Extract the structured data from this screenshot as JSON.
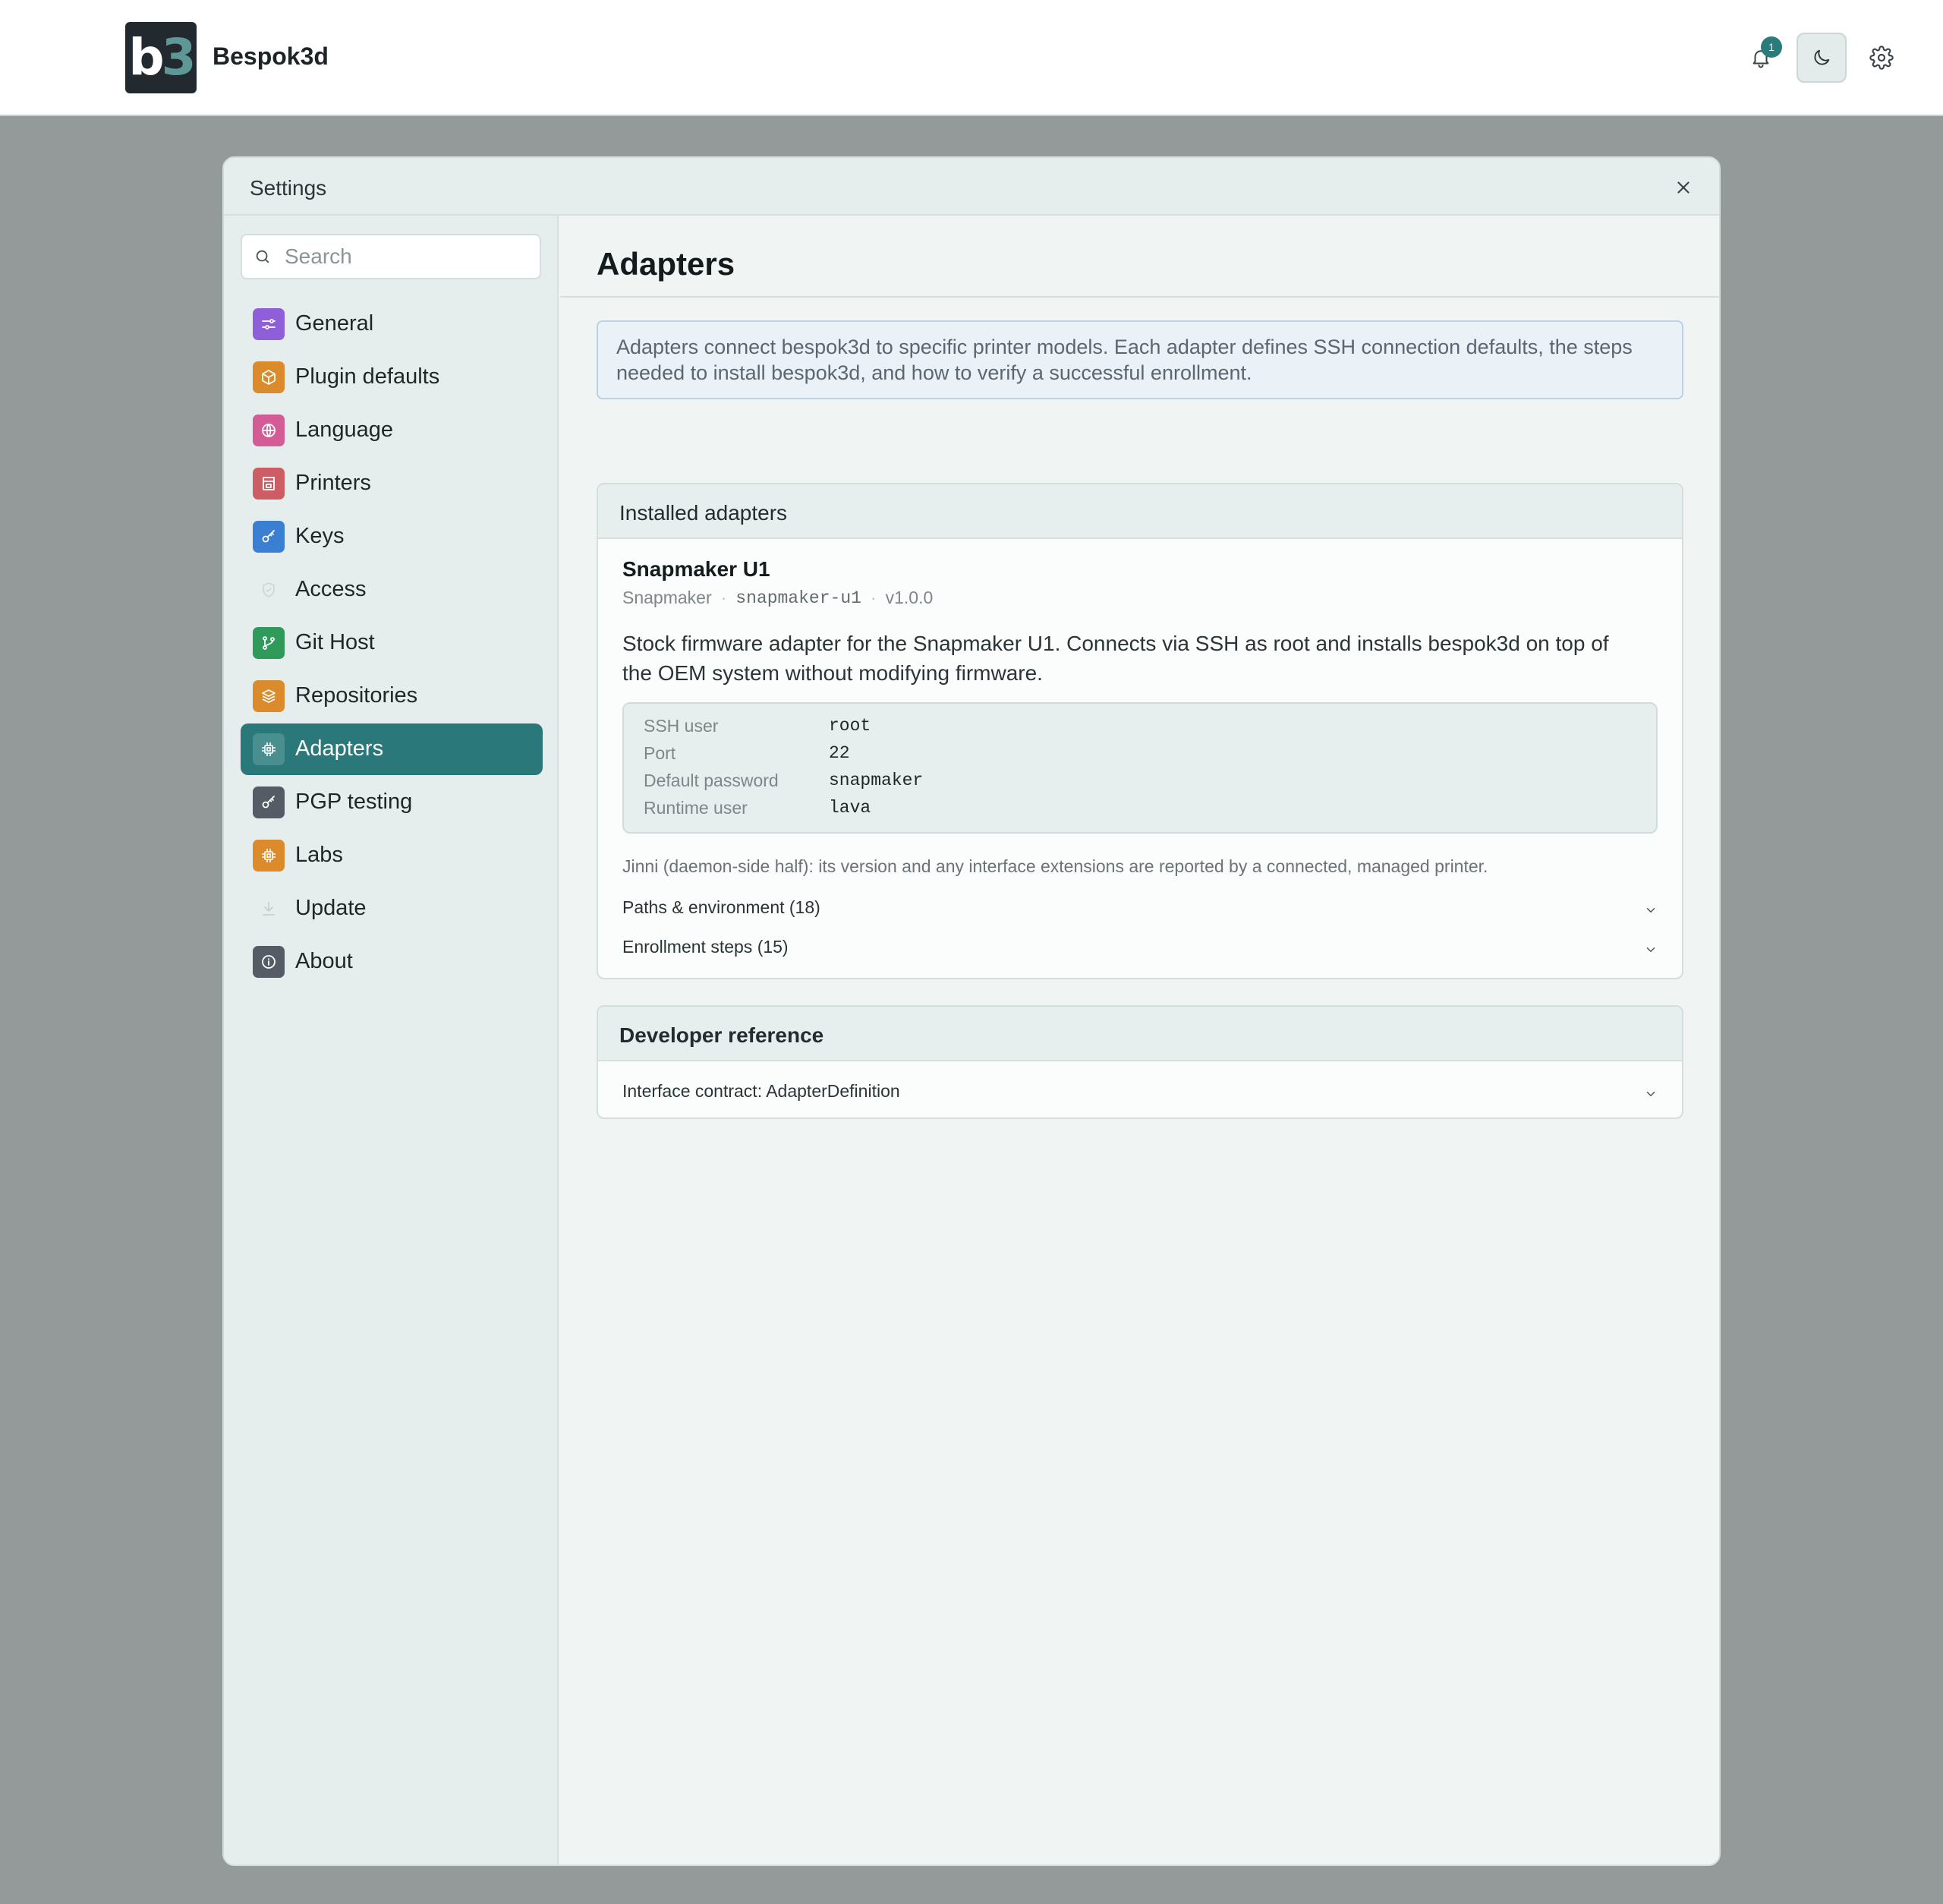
{
  "app": {
    "logo_text_b": "b",
    "logo_text_3": "3",
    "brand": "Bespok3d",
    "notification_count": "1",
    "icons": [
      "bell-icon",
      "moon-icon",
      "gear-icon"
    ]
  },
  "modal": {
    "title": "Settings",
    "search": {
      "placeholder": "Search"
    },
    "sidebar": {
      "items": [
        {
          "label": "General",
          "icon": "sliders-icon",
          "color": "#8e5fd9"
        },
        {
          "label": "Plugin defaults",
          "icon": "box-icon",
          "color": "#db8a2c"
        },
        {
          "label": "Language",
          "icon": "globe-icon",
          "color": "#d45c96"
        },
        {
          "label": "Printers",
          "icon": "printer-icon",
          "color": "#cc5d64"
        },
        {
          "label": "Keys",
          "icon": "key-icon",
          "color": "#3a7fd1"
        },
        {
          "label": "Access",
          "icon": "shield-icon",
          "color": ""
        },
        {
          "label": "Git Host",
          "icon": "git-branch-icon",
          "color": "#2f9a59"
        },
        {
          "label": "Repositories",
          "icon": "layers-icon",
          "color": "#db8a2c"
        },
        {
          "label": "Adapters",
          "icon": "chip-icon",
          "color": "#2a7879",
          "active": true
        },
        {
          "label": "PGP testing",
          "icon": "key-icon",
          "color": "#555c66"
        },
        {
          "label": "Labs",
          "icon": "chip-icon",
          "color": "#db8a2c"
        },
        {
          "label": "Update",
          "icon": "download-icon",
          "color": ""
        },
        {
          "label": "About",
          "icon": "info-icon",
          "color": "#555c66"
        }
      ]
    },
    "main": {
      "title": "Adapters",
      "info": "Adapters connect bespok3d to specific printer models. Each adapter defines SSH connection defaults, the steps needed to install bespok3d, and how to verify a successful enrollment.",
      "installed": {
        "heading": "Installed adapters",
        "adapter": {
          "name": "Snapmaker U1",
          "vendor": "Snapmaker",
          "id": "snapmaker-u1",
          "version": "v1.0.0",
          "description": "Stock firmware adapter for the Snapmaker U1. Connects via SSH as root and installs bespok3d on top of the OEM system without modifying firmware.",
          "defaults": [
            {
              "key": "SSH user",
              "value": "root"
            },
            {
              "key": "Port",
              "value": "22"
            },
            {
              "key": "Default password",
              "value": "snapmaker"
            },
            {
              "key": "Runtime user",
              "value": "lava"
            }
          ],
          "jinni_note": "Jinni (daemon-side half): its version and any interface extensions are reported by a connected, managed printer.",
          "paths_label": "Paths & environment (18)",
          "enrollment_label": "Enrollment steps (15)"
        }
      },
      "developer": {
        "heading": "Developer reference",
        "contract_label": "Interface contract: AdapterDefinition"
      }
    }
  },
  "colors": {
    "accent": "#2a7879",
    "backdrop": "#949a9a",
    "info_bg": "#eaf1f7"
  }
}
